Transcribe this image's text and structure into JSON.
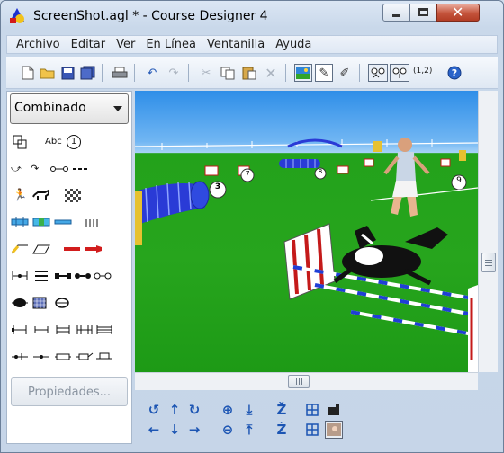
{
  "window": {
    "title": "ScreenShot.agl * - Course Designer 4",
    "close_glyph": "✕"
  },
  "menubar": {
    "items": [
      "Archivo",
      "Editar",
      "Ver",
      "En Línea",
      "Ventanilla",
      "Ayuda"
    ]
  },
  "toolbar": {
    "icons": [
      "new-file-icon",
      "open-folder-icon",
      "save-icon",
      "save-all-icon",
      "print-icon",
      "undo-icon",
      "redo-icon",
      "cut-icon",
      "copy-icon",
      "paste-icon",
      "delete-icon",
      "view-3d-icon",
      "edit-pencil-icon",
      "pen-icon",
      "camera-follow-icon",
      "camera-walk-icon",
      "coordinates-icon",
      "help-icon"
    ],
    "coordinates_label": "(1,2)"
  },
  "palette": {
    "category_selected": "Combinado",
    "properties_button": "Propiedades...",
    "abc_label": "Abc",
    "number_label": "1"
  },
  "viewport": {
    "markers": [
      "3",
      "7",
      "8",
      "9"
    ]
  },
  "colors": {
    "accent": "#1c55b3",
    "grass": "#27a51d",
    "sky": "#71b6f3",
    "tunnel": "#2a3bd6"
  }
}
